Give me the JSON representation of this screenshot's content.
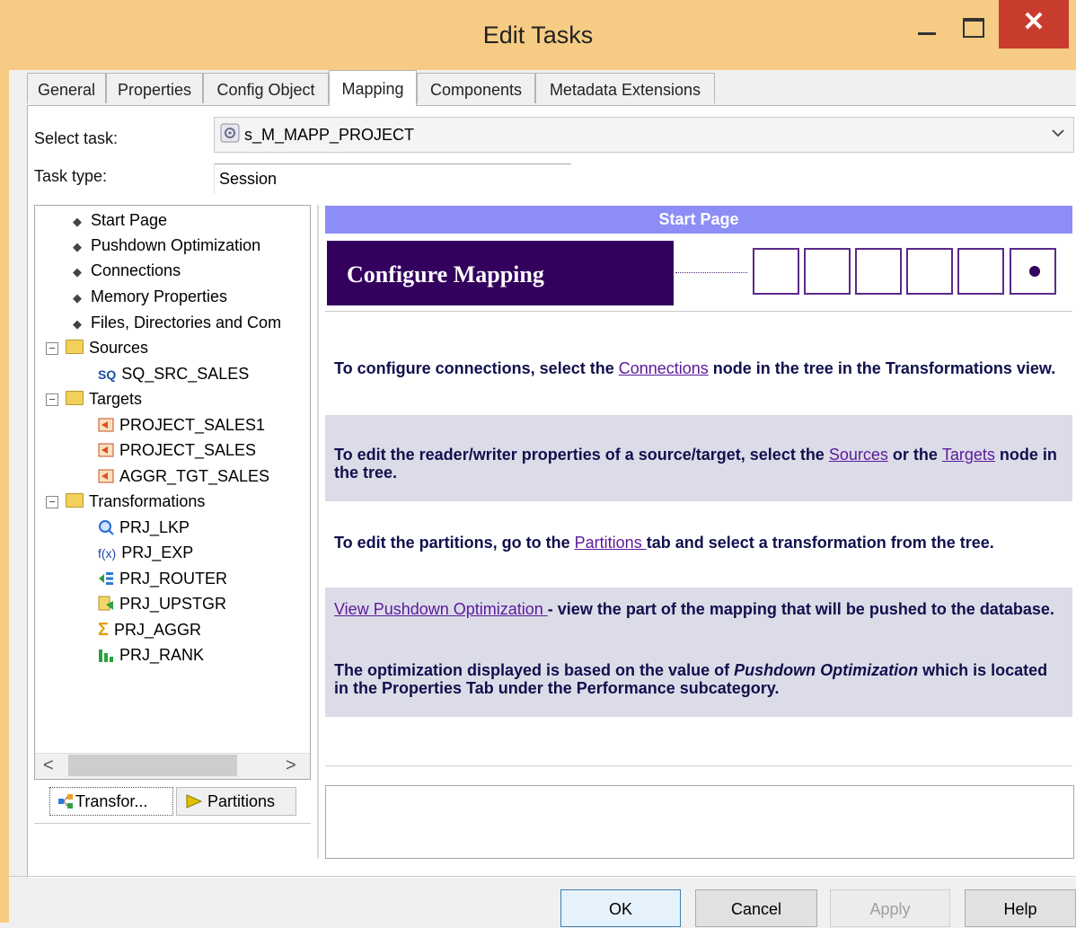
{
  "window": {
    "title": "Edit Tasks",
    "close_glyph": "✕"
  },
  "tabs": [
    "General",
    "Properties",
    "Config Object",
    "Mapping",
    "Components",
    "Metadata Extensions"
  ],
  "select_task": {
    "label": "Select task:",
    "value": "s_M_MAPP_PROJECT"
  },
  "task_type": {
    "label": "Task type:",
    "value": "Session"
  },
  "tree": {
    "top_items": [
      "Start Page",
      "Pushdown Optimization",
      "Connections",
      "Memory Properties",
      "Files, Directories and Com"
    ],
    "sources": {
      "label": "Sources",
      "expander": "−",
      "items": [
        {
          "icon_text": "SQ",
          "label": "SQ_SRC_SALES"
        }
      ]
    },
    "targets": {
      "label": "Targets",
      "expander": "−",
      "items": [
        "PROJECT_SALES1",
        "PROJECT_SALES",
        "AGGR_TGT_SALES"
      ]
    },
    "transformations": {
      "label": "Transformations",
      "expander": "−",
      "items": [
        {
          "label": "PRJ_LKP",
          "icon": "lookup-icon"
        },
        {
          "label": "PRJ_EXP",
          "icon": "expression-icon",
          "icon_text": "f(x)"
        },
        {
          "label": "PRJ_ROUTER",
          "icon": "router-icon"
        },
        {
          "label": "PRJ_UPSTGR",
          "icon": "update-strategy-icon"
        },
        {
          "label": "PRJ_AGGR",
          "icon": "aggregator-icon",
          "icon_text": "Σ"
        },
        {
          "label": "PRJ_RANK",
          "icon": "rank-icon"
        }
      ]
    },
    "scroll_left": "<",
    "scroll_right": ">"
  },
  "bottom_tabs": {
    "transformations": "Transfor...",
    "partitions": "Partitions"
  },
  "start_page": {
    "header": "Start Page",
    "banner": "Configure Mapping",
    "msg1": {
      "before": "To configure connections, select the ",
      "link": "Connections",
      "after": " node in the tree in the Transformations view."
    },
    "msg2": {
      "before": "To edit the reader/writer properties of a source/target, select the ",
      "link1": "Sources",
      "middle": " or the ",
      "link2": "Targets",
      "after": " node in the tree."
    },
    "msg3": {
      "before": "To edit the partitions, go to the ",
      "link": "Partitions ",
      "after": "tab and select a transformation from the tree."
    },
    "msg4": {
      "link": "View Pushdown Optimization ",
      "after": "- view the part of the mapping that will be pushed to the database."
    },
    "msg5": {
      "before": "The optimization displayed is based on the value of ",
      "italic": "Pushdown Optimization",
      "after": " which is located in the Properties Tab under the Performance subcategory."
    }
  },
  "buttons": {
    "ok": "OK",
    "cancel": "Cancel",
    "apply": "Apply",
    "help": "Help"
  },
  "colors": {
    "title_bar": "#f6cc84",
    "close_button": "#c83c2e",
    "header_bar": "#8d8df7",
    "banner": "#33005e",
    "link": "#5a1a9a"
  }
}
